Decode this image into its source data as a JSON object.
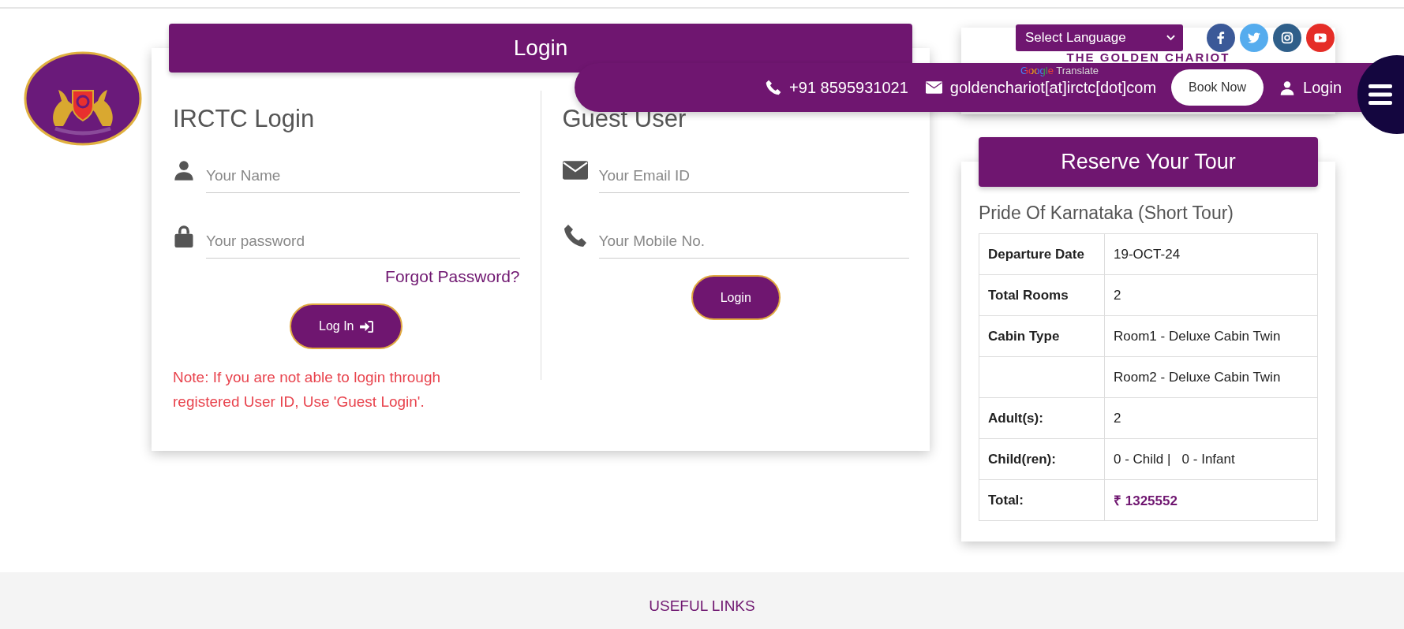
{
  "header": {
    "language_select": "Select Language",
    "brand": "THE GOLDEN CHARIOT",
    "translate": {
      "google": "Google",
      "label": "Translate"
    },
    "social": [
      {
        "kind": "facebook"
      },
      {
        "kind": "twitter"
      },
      {
        "kind": "instagram"
      },
      {
        "kind": "youtube"
      }
    ],
    "phone": "+91 8595931021",
    "email": "goldenchariot[at]irctc[dot]com",
    "book_button": "Book Now",
    "login_link": "Login"
  },
  "login": {
    "title": "Login",
    "irctc": {
      "heading": "IRCTC Login",
      "fields": [
        {
          "kind": "user",
          "placeholder": "Your Name"
        },
        {
          "kind": "lock",
          "placeholder": "Your password"
        }
      ],
      "forgot": "Forgot Password?",
      "button": "Log In",
      "note": "Note: If you are not able to login through registered User ID, Use 'Guest Login'."
    },
    "guest": {
      "heading": "Guest User",
      "fields": [
        {
          "kind": "mail",
          "placeholder": "Your Email ID"
        },
        {
          "kind": "phone",
          "placeholder": "Your Mobile No."
        }
      ],
      "button": "Login"
    }
  },
  "reserve": {
    "title": "Reserve Your Tour",
    "tour": "Pride Of Karnataka (Short Tour)",
    "rows": [
      {
        "label": "Departure Date",
        "value": "19-OCT-24",
        "kind": "plain"
      },
      {
        "label": "Total Rooms",
        "value": "2",
        "kind": "plain"
      },
      {
        "label": "Cabin Type",
        "value": "Room1 - Deluxe Cabin Twin",
        "kind": "plain"
      },
      {
        "value": "Room2 - Deluxe Cabin Twin",
        "kind": "plain"
      },
      {
        "label": "Adult(s):",
        "value": "2",
        "kind": "plain"
      },
      {
        "label": "Child(ren):",
        "value": "0 - Child |   0 - Infant",
        "kind": "plain"
      },
      {
        "label": "Total:",
        "value": "₹ 1325552",
        "kind": "total"
      }
    ]
  },
  "footer": {
    "heading": "USEFUL LINKS"
  }
}
